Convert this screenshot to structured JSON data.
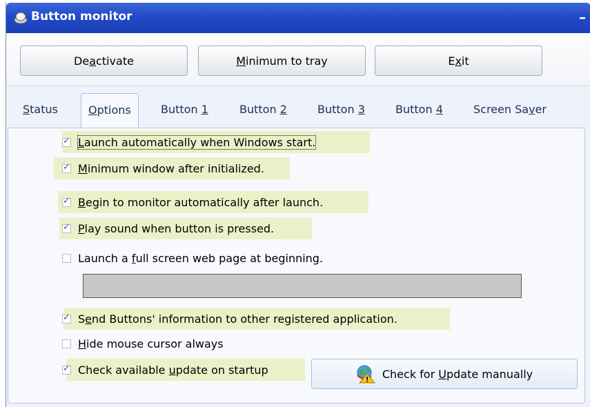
{
  "window": {
    "title": "Button monitor",
    "minimize_label": "–"
  },
  "toolbar": {
    "deactivate": {
      "pre": "De",
      "key": "a",
      "post": "ctivate"
    },
    "minimum_to_tray": {
      "pre": "",
      "key": "M",
      "post": "inimum to tray"
    },
    "exit": {
      "pre": "E",
      "key": "x",
      "post": "it"
    }
  },
  "tabs": [
    {
      "pre": "",
      "key": "S",
      "post": "tatus"
    },
    {
      "pre": "",
      "key": "O",
      "post": "ptions"
    },
    {
      "pre": "Button ",
      "key": "1",
      "post": ""
    },
    {
      "pre": "Button ",
      "key": "2",
      "post": ""
    },
    {
      "pre": "Button ",
      "key": "3",
      "post": ""
    },
    {
      "pre": "Button ",
      "key": "4",
      "post": ""
    },
    {
      "pre": "Screen Sa",
      "key": "v",
      "post": "er"
    }
  ],
  "active_tab": "Options",
  "options": {
    "launch_auto": {
      "pre": "",
      "key": "L",
      "post": "aunch automatically when Windows start.",
      "checked": true
    },
    "min_window": {
      "pre": "",
      "key": "M",
      "post": "inimum window after initialized.",
      "checked": true
    },
    "begin_monitor": {
      "pre": "",
      "key": "B",
      "post": "egin to monitor automatically after launch.",
      "checked": true
    },
    "play_sound": {
      "pre": "",
      "key": "P",
      "post": "lay sound when button is pressed.",
      "checked": true
    },
    "full_screen": {
      "pre": "Launch a ",
      "key": "f",
      "post": "ull screen web page at beginning.",
      "checked": false
    },
    "send_info": {
      "pre": "S",
      "key": "e",
      "post": "nd Buttons' information to other registered application.",
      "checked": true
    },
    "hide_cursor": {
      "pre": "",
      "key": "H",
      "post": "ide mouse cursor always",
      "checked": false
    },
    "check_update": {
      "pre": "Check available ",
      "key": "u",
      "post": "pdate on startup",
      "checked": true
    }
  },
  "web_page_url": "",
  "check_update_button": {
    "pre": "Check for ",
    "key": "U",
    "post": "pdate manually"
  },
  "colors": {
    "title_bar": "#2149c8",
    "highlight": "#ecf0c8",
    "tab_panel": "#f7f9fd"
  }
}
